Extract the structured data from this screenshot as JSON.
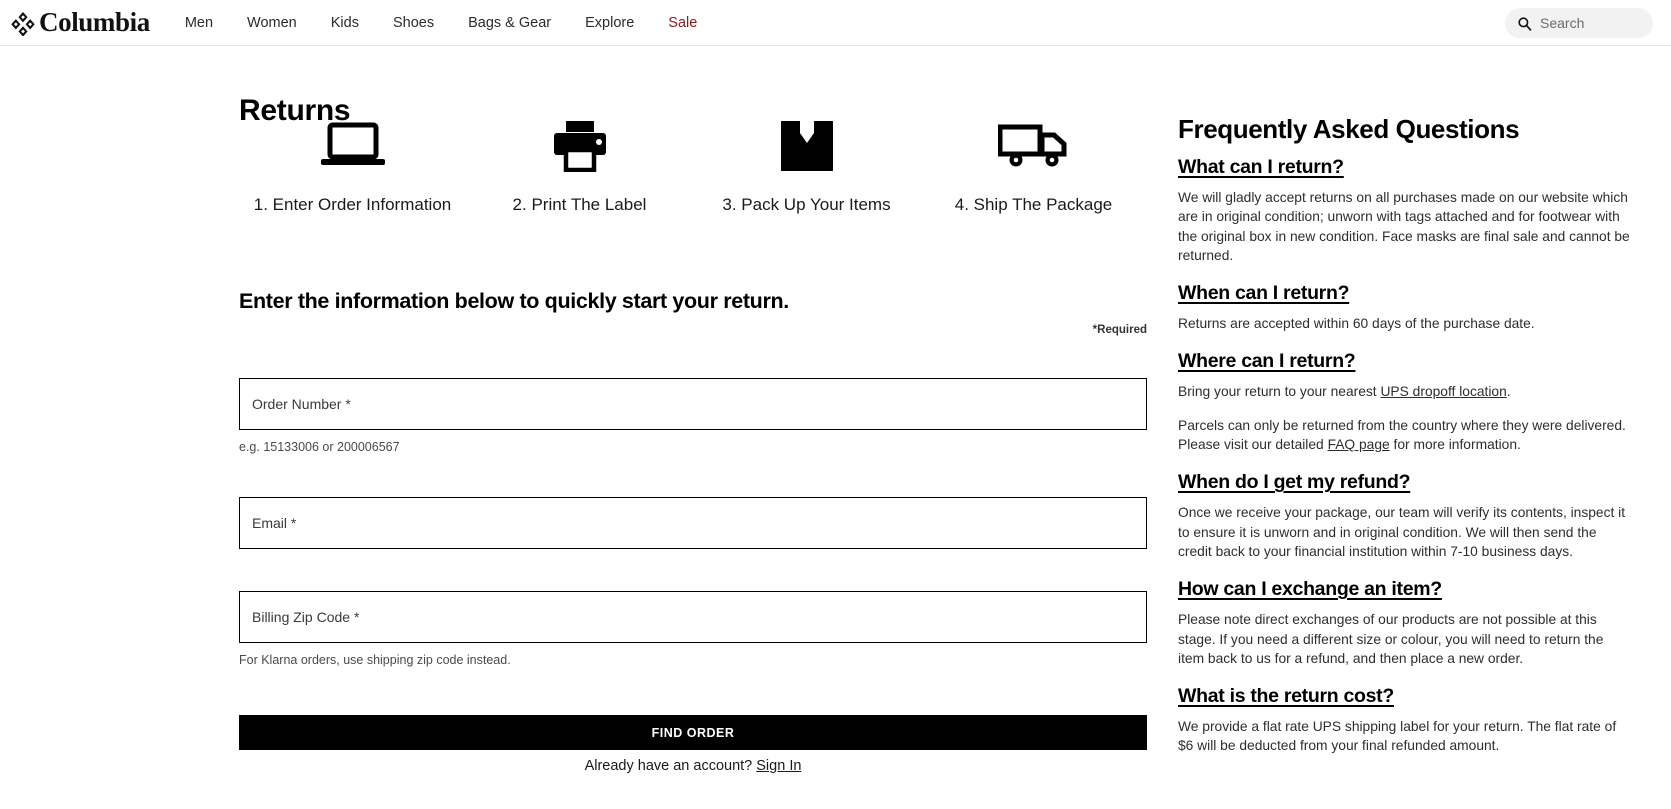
{
  "header": {
    "brand": "Columbia",
    "brand_icon": "columbia-diamond-logo",
    "nav": [
      {
        "label": "Men",
        "name": "men"
      },
      {
        "label": "Women",
        "name": "women"
      },
      {
        "label": "Kids",
        "name": "kids"
      },
      {
        "label": "Shoes",
        "name": "shoes"
      },
      {
        "label": "Bags & Gear",
        "name": "bags-gear"
      },
      {
        "label": "Explore",
        "name": "explore"
      },
      {
        "label": "Sale",
        "name": "sale"
      }
    ],
    "sale_color": "#8a1c1c",
    "search": {
      "placeholder": "Search",
      "icon": "search-icon"
    }
  },
  "page": {
    "title": "Returns"
  },
  "steps": [
    {
      "icon": "laptop-icon",
      "label": "1. Enter Order Information"
    },
    {
      "icon": "printer-icon",
      "label": "2. Print The Label"
    },
    {
      "icon": "box-icon",
      "label": "3. Pack Up Your Items"
    },
    {
      "icon": "truck-icon",
      "label": "4. Ship The Package"
    }
  ],
  "form": {
    "heading": "Enter the information below to quickly start your return.",
    "required_note": "*Required",
    "fields": [
      {
        "name": "order-number",
        "label": "Order Number *",
        "value": "",
        "placeholder": "Order Number *",
        "hint": "e.g. 15133006 or 200006567"
      },
      {
        "name": "email",
        "label": "Email *",
        "value": "",
        "placeholder": "Email *",
        "hint": ""
      },
      {
        "name": "billing-zip",
        "label": "Billing Zip Code *",
        "value": "",
        "placeholder": "Billing Zip Code *",
        "hint": "For Klarna orders, use shipping zip code instead."
      }
    ],
    "submit_label": "FIND ORDER",
    "account_prompt": "Already have an account?",
    "sign_in_label": "Sign In"
  },
  "faq": {
    "title": "Frequently Asked Questions",
    "items": [
      {
        "question": "What can I return?",
        "answer": "We will gladly accept returns on all purchases made on our website which are in original condition; unworn with tags attached and for footwear with the original box in new condition. Face masks are final sale and cannot be returned."
      },
      {
        "question": "When can I return?",
        "answer": "Returns are accepted within 60 days of the purchase date."
      },
      {
        "question": "Where can I return?",
        "answer_prefix": "Bring your return to your nearest ",
        "answer_link": "UPS dropoff location",
        "answer_suffix": ".",
        "answer2_prefix": "Parcels can only be returned from the country where they were delivered. Please visit our detailed ",
        "answer2_link": "FAQ page",
        "answer2_suffix": " for more information."
      },
      {
        "question": "When do I get my refund?",
        "answer": "Once we receive your package, our team will verify its contents, inspect it to ensure it is unworn and in original condition. We will then send the credit back to your financial institution within 7-10 business days."
      },
      {
        "question": "How can I exchange an item?",
        "answer": "Please note direct exchanges of our products are not possible at this stage. If you need a different size or colour, you will need to return the item back to us for a refund, and then place a new order."
      },
      {
        "question": "What is the return cost?",
        "answer": "We provide a flat rate UPS shipping label for your return. The flat rate of $6 will be deducted from your final refunded amount."
      }
    ]
  }
}
